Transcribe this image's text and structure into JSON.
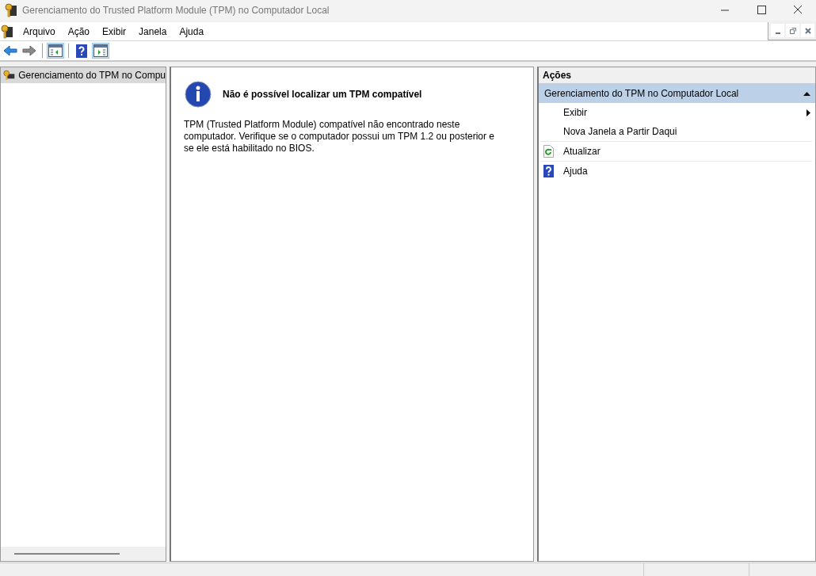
{
  "window": {
    "title": "Gerenciamento do Trusted Platform Module (TPM) no Computador Local"
  },
  "menu": [
    "Arquivo",
    "Ação",
    "Exibir",
    "Janela",
    "Ajuda"
  ],
  "toolbar": [
    [
      {
        "kind": "back",
        "on": false
      },
      {
        "kind": "forward",
        "on": false
      }
    ],
    [
      {
        "kind": "pane-left",
        "on": true
      }
    ],
    [
      {
        "kind": "help",
        "on": false
      },
      {
        "kind": "pane-right",
        "on": true
      }
    ]
  ],
  "tree": {
    "items": [
      {
        "label": "Gerenciamento do TPM no Compu",
        "selected": true
      }
    ]
  },
  "content": {
    "heading": "Não é possível localizar um TPM compatível",
    "body": "TPM (Trusted Platform Module) compatível não encontrado neste computador. Verifique se o computador possui um TPM 1.2 ou posterior e se ele está habilitado no BIOS."
  },
  "actions": {
    "title": "Ações",
    "section": {
      "label": "Gerenciamento do TPM no Computador Local",
      "expanded": true
    },
    "items": [
      {
        "label": "Exibir",
        "kind": "submenu"
      },
      {
        "label": "Nova Janela a Partir Daqui",
        "kind": "plain"
      },
      {
        "label": "Atualizar",
        "kind": "refresh"
      },
      {
        "label": "Ajuda",
        "kind": "help"
      }
    ]
  }
}
